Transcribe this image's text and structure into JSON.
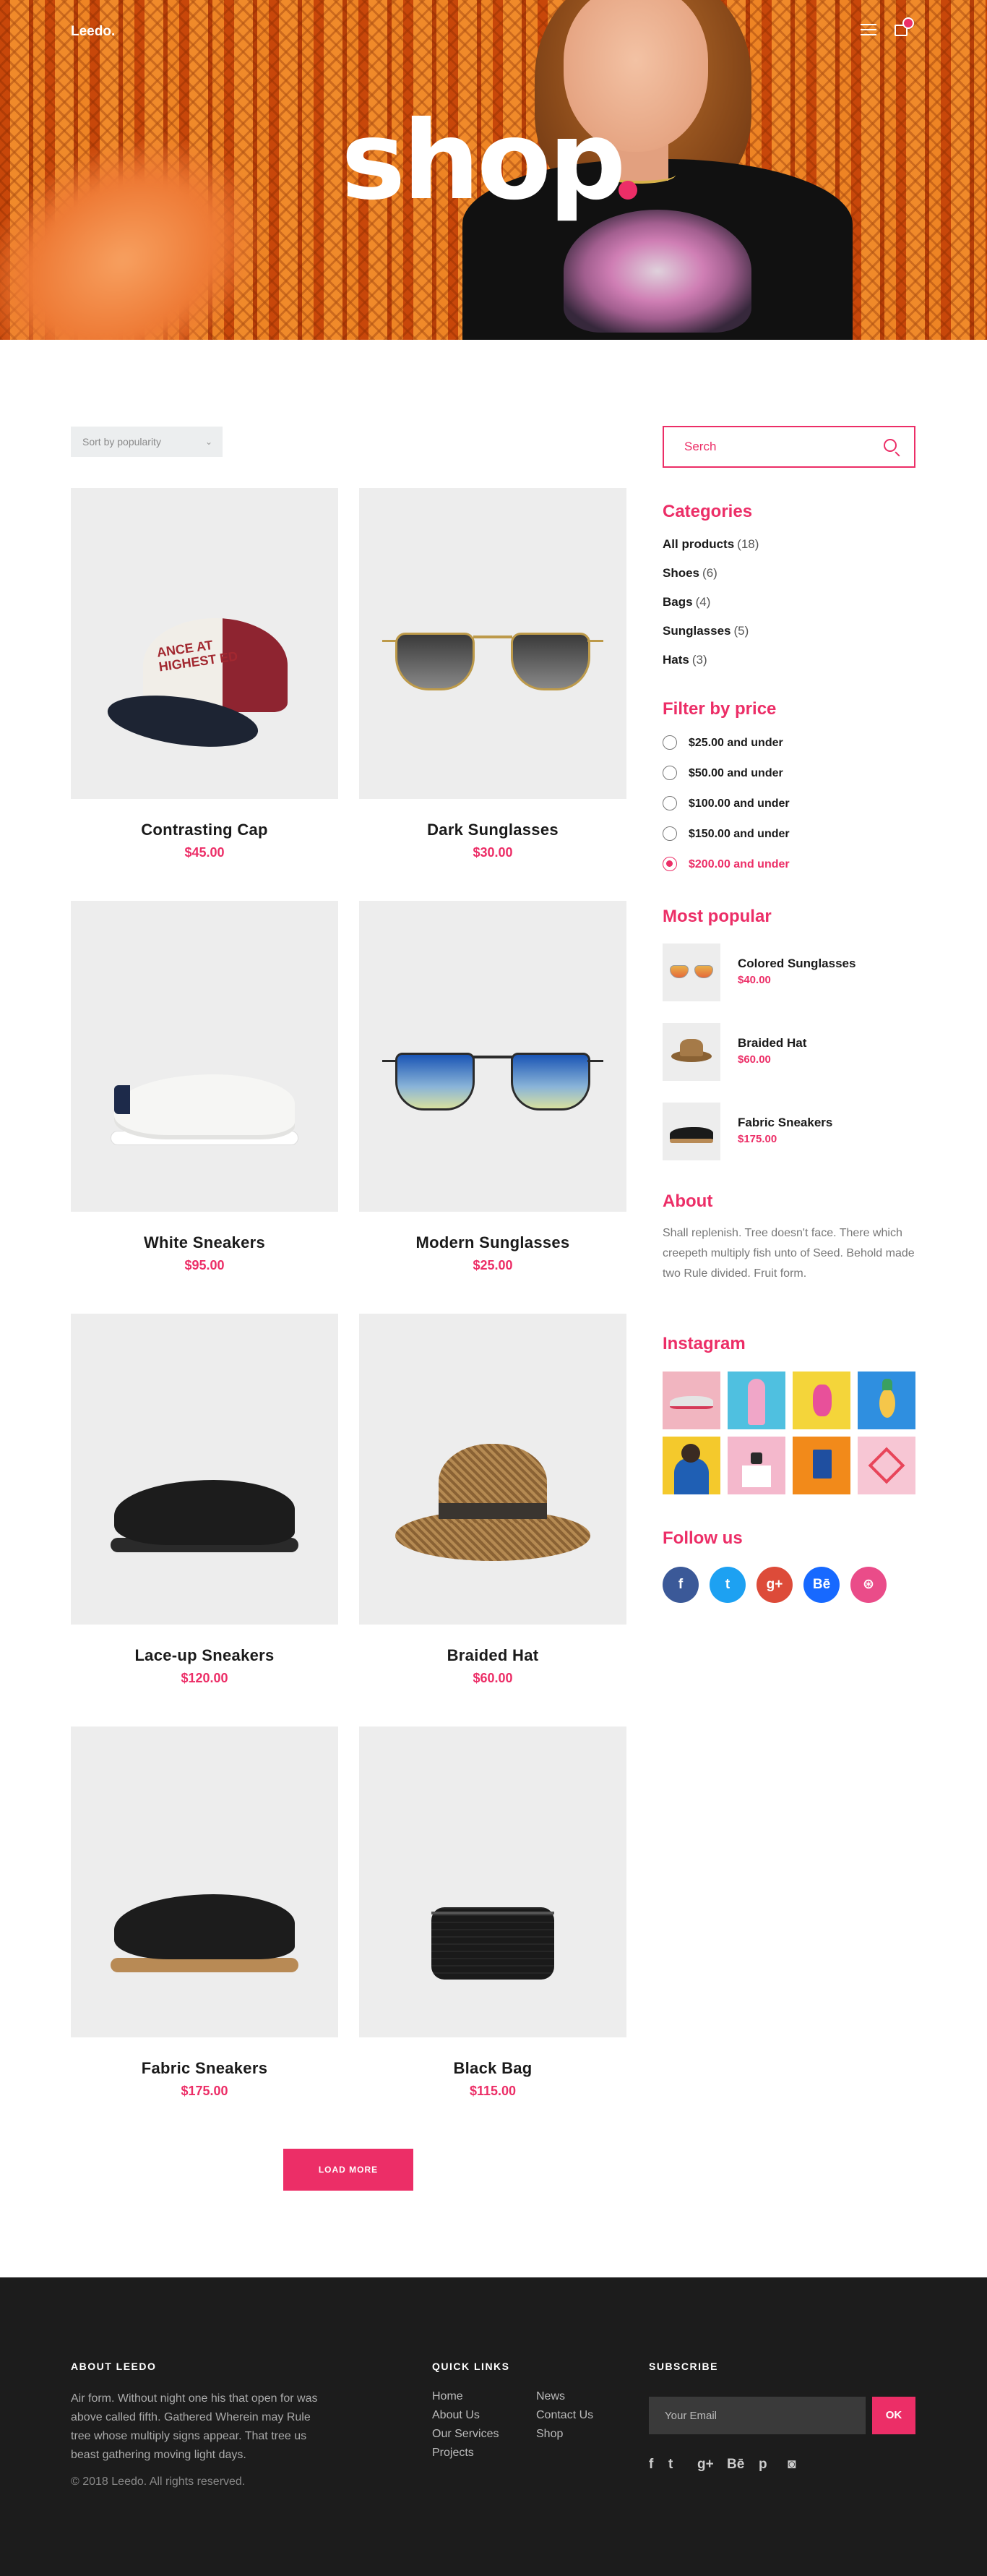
{
  "header": {
    "logo": "Leedo.",
    "hero_title": "shop"
  },
  "sort": {
    "label": "Sort by popularity"
  },
  "products": [
    {
      "name": "Contrasting Cap",
      "price": "$45.00"
    },
    {
      "name": "Dark Sunglasses",
      "price": "$30.00"
    },
    {
      "name": "White Sneakers",
      "price": "$95.00"
    },
    {
      "name": "Modern Sunglasses",
      "price": "$25.00"
    },
    {
      "name": "Lace-up Sneakers",
      "price": "$120.00"
    },
    {
      "name": "Braided Hat",
      "price": "$60.00"
    },
    {
      "name": "Fabric Sneakers",
      "price": "$175.00"
    },
    {
      "name": "Black Bag",
      "price": "$115.00"
    }
  ],
  "cap_print": "ANCE AT HIGHEST ED",
  "load_more": "LOAD MORE",
  "sidebar": {
    "search_placeholder": "Serch",
    "categories_title": "Categories",
    "categories": [
      {
        "label": "All products",
        "count": "(18)"
      },
      {
        "label": "Shoes",
        "count": "(6)"
      },
      {
        "label": "Bags",
        "count": "(4)"
      },
      {
        "label": "Sunglasses",
        "count": "(5)"
      },
      {
        "label": "Hats",
        "count": "(3)"
      }
    ],
    "price_title": "Filter by price",
    "prices": [
      "$25.00 and under",
      "$50.00 and under",
      "$100.00 and under",
      "$150.00 and under",
      "$200.00 and under"
    ],
    "popular_title": "Most popular",
    "popular": [
      {
        "name": "Colored Sunglasses",
        "price": "$40.00"
      },
      {
        "name": "Braided Hat",
        "price": "$60.00"
      },
      {
        "name": "Fabric Sneakers",
        "price": "$175.00"
      }
    ],
    "about_title": "About",
    "about_text": "Shall replenish. Tree doesn't face. There which creepeth multiply fish unto of Seed. Behold made two Rule divided. Fruit form.",
    "instagram_title": "Instagram",
    "follow_title": "Follow us",
    "social": [
      "f",
      "t",
      "g+",
      "Bē",
      "⊛"
    ]
  },
  "footer": {
    "about_title": "ABOUT LEEDO",
    "about_text": "Air form. Without night one his that open for was above called fifth. Gathered Wherein may Rule tree whose multiply signs appear. That tree us beast gathering moving light days.",
    "copyright": "© 2018 Leedo. All rights reserved.",
    "links_title": "QUICK LINKS",
    "links": [
      "Home",
      "About Us",
      "Our Services",
      "Projects",
      "News",
      "Contact Us",
      "Shop"
    ],
    "subscribe_title": "SUBSCRIBE",
    "email_placeholder": "Your Email",
    "ok_label": "OK",
    "social": [
      "f",
      "t",
      "g+",
      "Bē",
      "p",
      "◙"
    ]
  },
  "colors": {
    "accent": "#ec2e67",
    "footer_bg": "#1c1c1c",
    "product_bg": "#ededed"
  }
}
